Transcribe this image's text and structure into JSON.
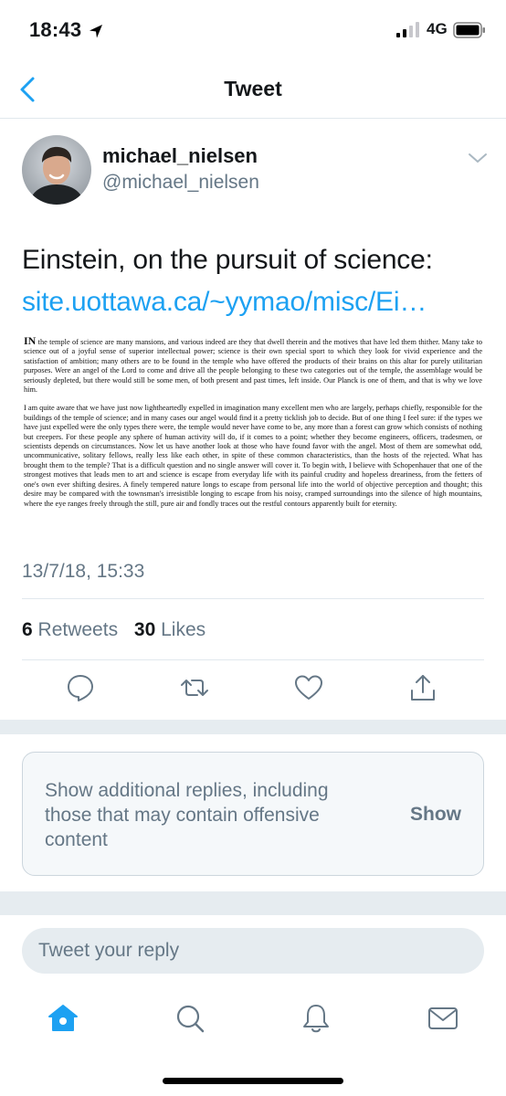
{
  "status_bar": {
    "time": "18:43",
    "network": "4G",
    "icons": [
      "location-arrow-icon",
      "signal-icon",
      "battery-icon"
    ]
  },
  "nav": {
    "title": "Tweet",
    "back_icon": "chevron-left-icon"
  },
  "tweet": {
    "author": {
      "display_name": "michael_nielsen",
      "handle": "@michael_nielsen"
    },
    "text": "Einstein, on the pursuit of science:",
    "link": "site.uottawa.ca/~yymao/misc/Ei…",
    "image_text": {
      "dropcap": "IN",
      "paragraph1": " the temple of science are many mansions, and various indeed are they that dwell therein and the motives that have led them thither. Many take to science out of a joyful sense of superior intellectual power; science is their own special sport to which they look for vivid experience and the satisfaction of ambition; many others are to be found in the temple who have offered the products of their brains on this altar for purely utilitarian purposes. Were an angel of the Lord to come and drive all the people belonging to these two categories out of the temple, the assemblage would be seriously depleted, but there would still be some men, of both present and past times, left inside. Our Planck is one of them, and that is why we love him.",
      "paragraph2": "I am quite aware that we have just now lightheartedly expelled in imagination many excellent men who are largely, perhaps chiefly, responsible for the buildings of the temple of science; and in many cases our angel would find it a pretty ticklish job to decide. But of one thing I feel sure: if the types we have just expelled were the only types there were, the temple would never have come to be, any more than a forest can grow which consists of nothing but creepers. For these people any sphere of human activity will do, if it comes to a point; whether they become engineers, officers, tradesmen, or scientists depends on circumstances. Now let us have another look at those who have found favor with the angel. Most of them are somewhat odd, uncommunicative, solitary fellows, really less like each other, in spite of these common characteristics, than the hosts of the rejected. What has brought them to the temple? That is a difficult question and no single answer will cover it. To begin with, I believe with Schopenhauer that one of the strongest motives that leads men to art and science is escape from everyday life with its painful crudity and hopeless dreariness, from the fetters of one's own ever shifting desires. A finely tempered nature longs to escape from personal life into the world of objective perception and thought; this desire may be compared with the townsman's irresistible longing to escape from his noisy, cramped surroundings into the silence of high mountains, where the eye ranges freely through the still, pure air and fondly traces out the restful contours apparently built for eternity."
    },
    "timestamp": "13/7/18, 15:33",
    "stats": {
      "retweets_count": "6",
      "retweets_label": "Retweets",
      "likes_count": "30",
      "likes_label": "Likes"
    },
    "actions": [
      "reply-icon",
      "retweet-icon",
      "like-icon",
      "share-icon"
    ]
  },
  "more_replies": {
    "text": "Show additional replies, including those that may contain offensive content",
    "button": "Show"
  },
  "reply": {
    "placeholder": "Tweet your reply"
  },
  "tab_bar": {
    "tabs": [
      "home-icon",
      "search-icon",
      "notifications-icon",
      "messages-icon"
    ],
    "active": "home-icon"
  },
  "colors": {
    "accent": "#1da1f2",
    "secondary_text": "#657786",
    "primary_text": "#14171a",
    "divider": "#e1e8ed",
    "band": "#e6ecf0"
  }
}
